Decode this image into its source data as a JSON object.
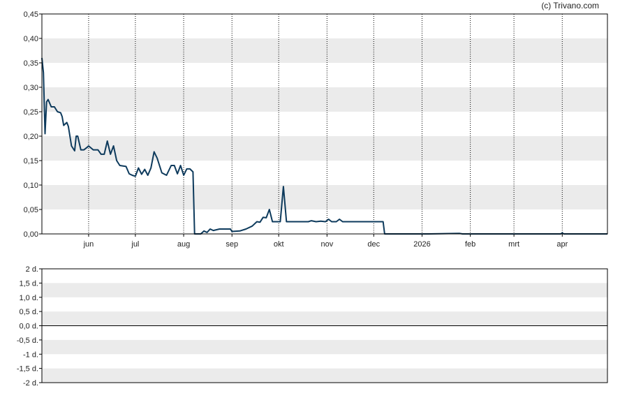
{
  "credit": "(c) Trivano.com",
  "colors": {
    "line": "#0d3a5c",
    "band": "#ebebeb",
    "frame": "#000000",
    "grid": "#000000"
  },
  "chart_data": [
    {
      "type": "line",
      "title": "",
      "xlabel": "",
      "ylabel": "",
      "ylim": [
        0,
        0.45
      ],
      "grid": true,
      "x_domain": [
        "2025-05-02",
        "2026-04-30"
      ],
      "y_tick_labels": [
        "0,00",
        "0,05",
        "0,10",
        "0,15",
        "0,20",
        "0,25",
        "0,30",
        "0,35",
        "0,40",
        "0,45"
      ],
      "x_ticks": [
        {
          "label": "jun",
          "date": "2025-06-01"
        },
        {
          "label": "jul",
          "date": "2025-07-01"
        },
        {
          "label": "aug",
          "date": "2025-08-01"
        },
        {
          "label": "sep",
          "date": "2025-09-01"
        },
        {
          "label": "okt",
          "date": "2025-10-01"
        },
        {
          "label": "nov",
          "date": "2025-11-01"
        },
        {
          "label": "dec",
          "date": "2025-12-01"
        },
        {
          "label": "2026",
          "date": "2026-01-01"
        },
        {
          "label": "feb",
          "date": "2026-02-01"
        },
        {
          "label": "mrt",
          "date": "2026-03-01"
        },
        {
          "label": "apr",
          "date": "2026-04-01"
        }
      ],
      "series": [
        {
          "points": [
            [
              "2025-05-02",
              0.36
            ],
            [
              "2025-05-03",
              0.33
            ],
            [
              "2025-05-04",
              0.205
            ],
            [
              "2025-05-05",
              0.27
            ],
            [
              "2025-05-06",
              0.275
            ],
            [
              "2025-05-08",
              0.26
            ],
            [
              "2025-05-10",
              0.26
            ],
            [
              "2025-05-12",
              0.25
            ],
            [
              "2025-05-14",
              0.248
            ],
            [
              "2025-05-15",
              0.24
            ],
            [
              "2025-05-16",
              0.222
            ],
            [
              "2025-05-18",
              0.228
            ],
            [
              "2025-05-19",
              0.22
            ],
            [
              "2025-05-21",
              0.18
            ],
            [
              "2025-05-23",
              0.17
            ],
            [
              "2025-05-24",
              0.2
            ],
            [
              "2025-05-25",
              0.2
            ],
            [
              "2025-05-27",
              0.172
            ],
            [
              "2025-05-29",
              0.172
            ],
            [
              "2025-05-31",
              0.177
            ],
            [
              "2025-06-01",
              0.18
            ],
            [
              "2025-06-04",
              0.172
            ],
            [
              "2025-06-07",
              0.172
            ],
            [
              "2025-06-09",
              0.163
            ],
            [
              "2025-06-11",
              0.163
            ],
            [
              "2025-06-13",
              0.19
            ],
            [
              "2025-06-15",
              0.163
            ],
            [
              "2025-06-17",
              0.18
            ],
            [
              "2025-06-19",
              0.15
            ],
            [
              "2025-06-21",
              0.14
            ],
            [
              "2025-06-25",
              0.138
            ],
            [
              "2025-06-27",
              0.123
            ],
            [
              "2025-06-29",
              0.12
            ],
            [
              "2025-07-01",
              0.118
            ],
            [
              "2025-07-03",
              0.135
            ],
            [
              "2025-07-05",
              0.122
            ],
            [
              "2025-07-07",
              0.132
            ],
            [
              "2025-07-09",
              0.12
            ],
            [
              "2025-07-11",
              0.135
            ],
            [
              "2025-07-13",
              0.168
            ],
            [
              "2025-07-15",
              0.155
            ],
            [
              "2025-07-18",
              0.125
            ],
            [
              "2025-07-21",
              0.12
            ],
            [
              "2025-07-24",
              0.14
            ],
            [
              "2025-07-26",
              0.14
            ],
            [
              "2025-07-28",
              0.123
            ],
            [
              "2025-07-30",
              0.14
            ],
            [
              "2025-08-01",
              0.12
            ],
            [
              "2025-08-03",
              0.133
            ],
            [
              "2025-08-05",
              0.133
            ],
            [
              "2025-08-07",
              0.127
            ],
            [
              "2025-08-08",
              0.0
            ],
            [
              "2025-08-12",
              0.0
            ],
            [
              "2025-08-14",
              0.006
            ],
            [
              "2025-08-16",
              0.003
            ],
            [
              "2025-08-18",
              0.01
            ],
            [
              "2025-08-20",
              0.007
            ],
            [
              "2025-08-24",
              0.01
            ],
            [
              "2025-08-26",
              0.01
            ],
            [
              "2025-08-31",
              0.01
            ],
            [
              "2025-09-01",
              0.005
            ],
            [
              "2025-09-06",
              0.006
            ],
            [
              "2025-09-10",
              0.01
            ],
            [
              "2025-09-14",
              0.016
            ],
            [
              "2025-09-17",
              0.025
            ],
            [
              "2025-09-19",
              0.024
            ],
            [
              "2025-09-21",
              0.034
            ],
            [
              "2025-09-23",
              0.033
            ],
            [
              "2025-09-25",
              0.05
            ],
            [
              "2025-09-27",
              0.025
            ],
            [
              "2025-10-02",
              0.025
            ],
            [
              "2025-10-04",
              0.097
            ],
            [
              "2025-10-06",
              0.025
            ],
            [
              "2025-10-14",
              0.025
            ],
            [
              "2025-10-20",
              0.025
            ],
            [
              "2025-10-22",
              0.027
            ],
            [
              "2025-10-25",
              0.025
            ],
            [
              "2025-10-28",
              0.026
            ],
            [
              "2025-10-31",
              0.025
            ],
            [
              "2025-11-02",
              0.03
            ],
            [
              "2025-11-04",
              0.025
            ],
            [
              "2025-11-07",
              0.025
            ],
            [
              "2025-11-09",
              0.03
            ],
            [
              "2025-11-11",
              0.025
            ],
            [
              "2025-11-20",
              0.025
            ],
            [
              "2025-12-01",
              0.025
            ],
            [
              "2025-12-07",
              0.025
            ],
            [
              "2025-12-08",
              0.0
            ],
            [
              "2026-01-05",
              0.0
            ],
            [
              "2026-01-25",
              0.001
            ],
            [
              "2026-01-27",
              0.0
            ],
            [
              "2026-03-20",
              0.0
            ],
            [
              "2026-03-31",
              0.0
            ],
            [
              "2026-04-01",
              0.002
            ],
            [
              "2026-04-02",
              0.0
            ],
            [
              "2026-04-30",
              0.0
            ]
          ]
        }
      ]
    },
    {
      "type": "line",
      "title": "",
      "xlabel": "",
      "ylabel": "",
      "ylim": [
        -2,
        2
      ],
      "grid": true,
      "y_tick_labels": [
        "-2 d.",
        "-1,5 d.",
        "-1 d.",
        "-0,5 d.",
        "0,0 d.",
        "0,5 d.",
        "1,0 d.",
        "1,5 d.",
        "2 d."
      ],
      "series": []
    }
  ]
}
